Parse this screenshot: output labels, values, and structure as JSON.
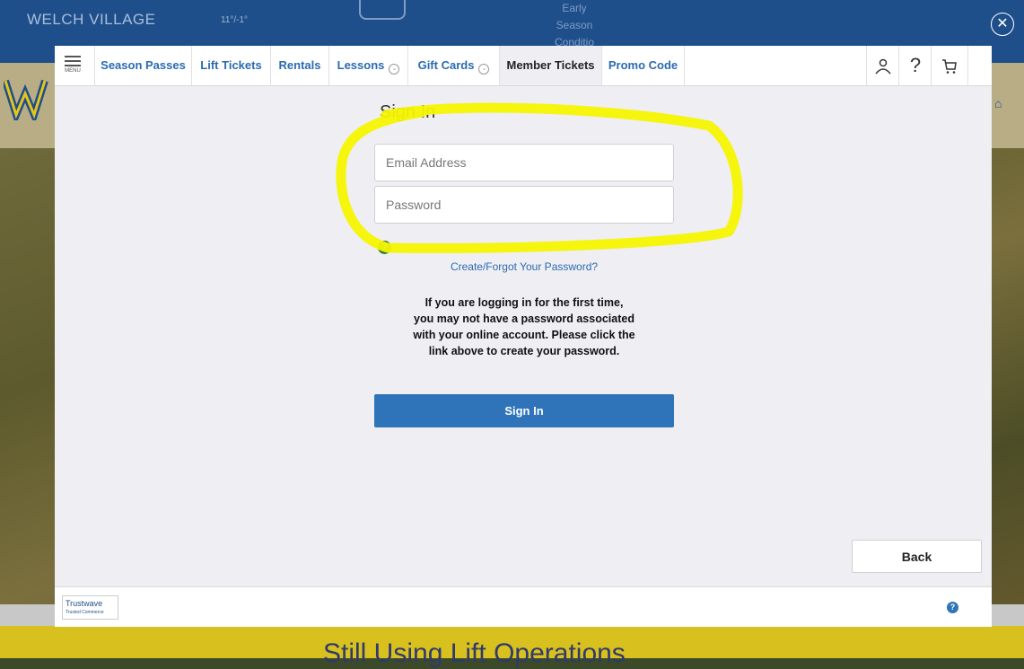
{
  "background": {
    "site_name": "WELCH VILLAGE",
    "weather": "11°/-1°",
    "status_lines": [
      "Early",
      "Season",
      "Conditio"
    ],
    "banner_text": "Still Using Lift Operations"
  },
  "nav": {
    "menu_label": "MENU",
    "tabs": [
      {
        "label": "Season Passes"
      },
      {
        "label": "Lift Tickets"
      },
      {
        "label": "Rentals"
      },
      {
        "label": "Lessons"
      },
      {
        "label": "Gift Cards"
      },
      {
        "label": "Member Tickets"
      },
      {
        "label": "Promo Code"
      }
    ],
    "icons": [
      "account-icon",
      "help-icon",
      "cart-icon"
    ],
    "help_glyph": "?"
  },
  "signin": {
    "title": "Sign In",
    "email_placeholder": "Email Address",
    "password_placeholder": "Password",
    "help_glyph": "?",
    "forgot_link": "Create/Forgot Your Password?",
    "info_lines": [
      "If you are logging in for the first time,",
      "you may not have a password associated",
      "with your online account. Please click the",
      "link above to create your password."
    ],
    "button_label": "Sign In"
  },
  "back_label": "Back",
  "footer": {
    "badge_name": "Trustwave",
    "badge_sub": "Trusted Commerce",
    "help_glyph": "?"
  },
  "colors": {
    "accent": "#2f74b8",
    "highlight": "#f4f400"
  }
}
